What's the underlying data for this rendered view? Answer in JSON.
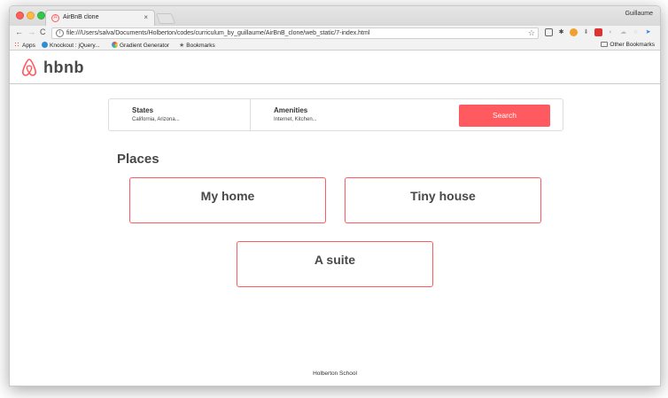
{
  "browser": {
    "user_name": "Guillaume",
    "tab": {
      "title": "AirBnB clone",
      "close": "×"
    },
    "nav": {
      "back": "←",
      "forward": "→",
      "reload": "C"
    },
    "omnibox": {
      "info": "i",
      "url": "file:///Users/salva/Documents/Holberton/codes/curriculum_by_guillaume/AirBnB_clone/web_static/7-index.html",
      "star": "☆"
    },
    "bookmarks": [
      {
        "label": "Apps",
        "icon": "apps-grid-icon"
      },
      {
        "label": "Knockout : jQuery...",
        "icon": "knockout-icon"
      },
      {
        "label": "Gradient Generator",
        "icon": "gradient-icon"
      },
      {
        "label": "Bookmarks",
        "icon": "star-icon"
      }
    ],
    "other_bookmarks": "Other Bookmarks"
  },
  "header": {
    "logo_text": "hbnb",
    "logo_color": "#ff5a5f"
  },
  "filters": {
    "states": {
      "title": "States",
      "value": "California, Arizona..."
    },
    "amenities": {
      "title": "Amenities",
      "value": "Internet, Kitchen..."
    },
    "search_label": "Search",
    "search_color": "#ff5a5f"
  },
  "places": {
    "title": "Places",
    "items": [
      {
        "name": "My home"
      },
      {
        "name": "Tiny house"
      },
      {
        "name": "A suite"
      }
    ]
  },
  "footer": {
    "text": "Holberton School"
  }
}
